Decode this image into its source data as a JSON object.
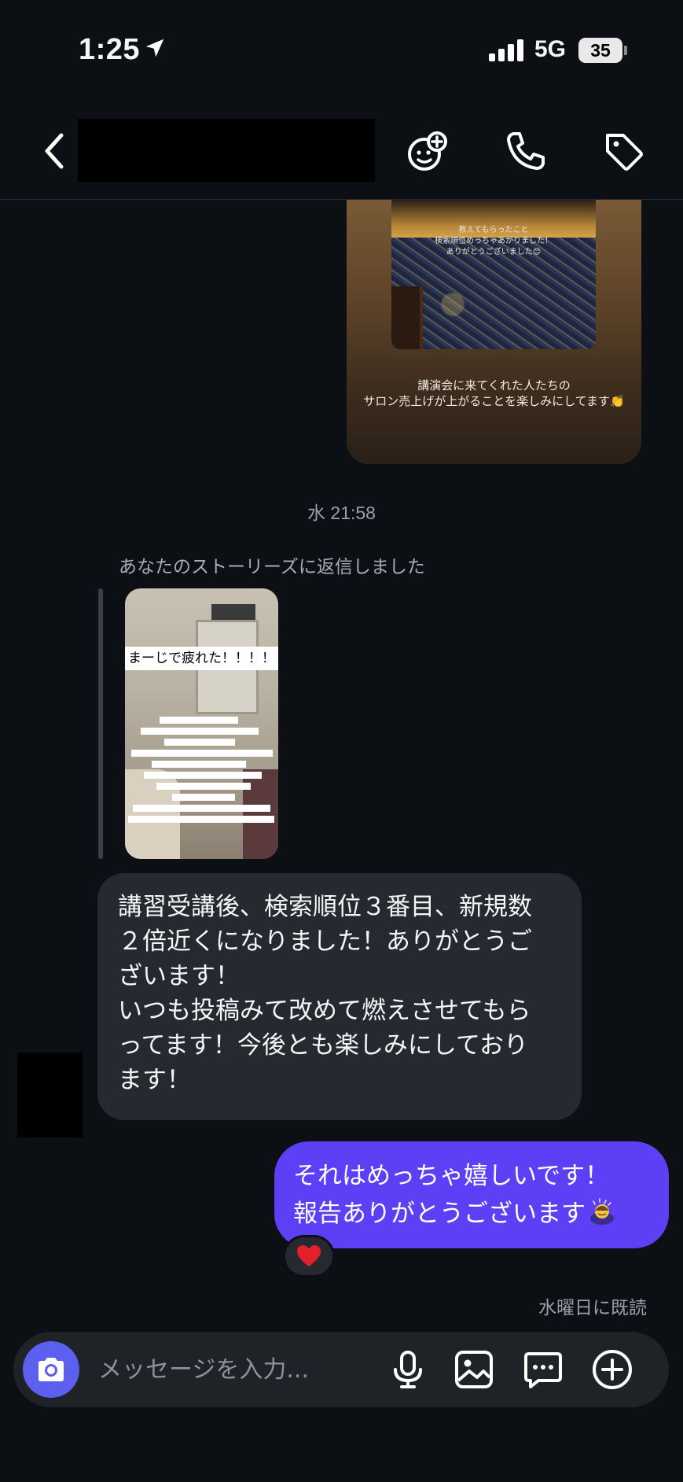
{
  "status_bar": {
    "time": "1:25",
    "network": "5G",
    "battery": "35",
    "icons": [
      "location-arrow-icon",
      "signal-bars-icon",
      "battery-icon"
    ]
  },
  "header": {
    "icons": [
      "chevron-left-icon",
      "effects-face-icon",
      "phone-icon",
      "tag-icon"
    ]
  },
  "thread": {
    "story_card": {
      "photo_text": [
        "教えてもらったこと",
        "検索順位めっちゃあがりました！",
        "ありがとうございました😊"
      ],
      "caption_line1": "講演会に来てくれた人たちの",
      "caption_line2": "サロン売上げが上がることを楽しみにしてます👏"
    },
    "timestamp": "水 21:58",
    "story_reply": {
      "label": "あなたのストーリーズに返信しました",
      "thumb_title": "まーじで疲れた！！！！"
    },
    "incoming_message": "講習受講後、検索順位３番目、新規数\n２倍近くになりました！ありがとうご\nざいます！\nいつも投稿みて改めて燃えさせてもら\nってます！今後とも楽しみにしており\nます！",
    "outgoing_message": "それはめっちゃ嬉しいです！\n報告ありがとうございます",
    "reaction": "❤️",
    "read_receipt": "水曜日に既読"
  },
  "composer": {
    "placeholder": "メッセージを入力...",
    "icons": [
      "camera-icon",
      "microphone-icon",
      "gallery-icon",
      "quick-reply-icon",
      "add-icon"
    ]
  },
  "colors": {
    "background": "#0c1014",
    "incoming_bubble": "#262a30",
    "outgoing_bubble": "#5d3ff5",
    "camera_button": "#5d5ff0"
  }
}
